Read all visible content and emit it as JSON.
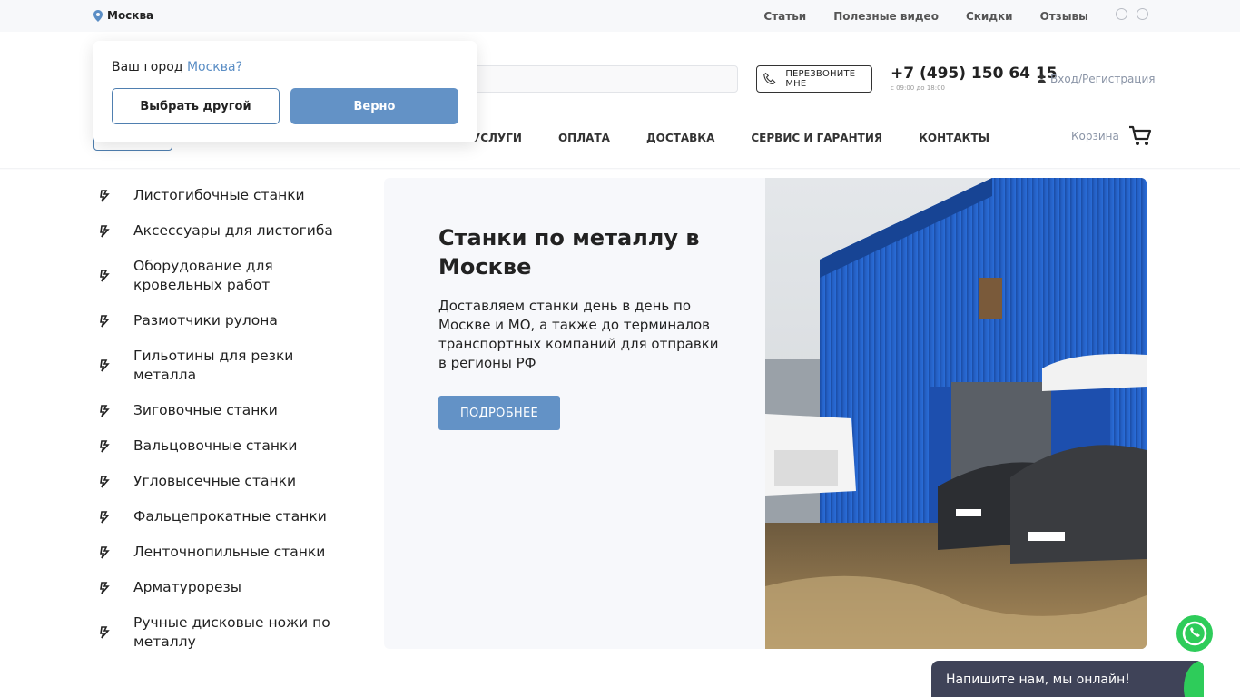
{
  "topbar": {
    "city": "Москва",
    "links": [
      "Статьи",
      "Полезные видео",
      "Скидки",
      "Отзывы"
    ]
  },
  "header": {
    "callback_label": "ПЕРЕЗВОНИТЕ МНЕ",
    "phone": "+7 (495) 150 64 15",
    "hours": "с 09:00 до 18:00",
    "login_label": "Вход/Регистрация"
  },
  "nav": {
    "items": [
      "УСЛУГИ",
      "ОПЛАТА",
      "ДОСТАВКА",
      "СЕРВИС И ГАРАНТИЯ",
      "КОНТАКТЫ"
    ],
    "cart_label": "Корзина"
  },
  "city_popup": {
    "question": "Ваш город",
    "city": "Москва?",
    "choose_other": "Выбрать другой",
    "confirm": "Верно"
  },
  "sidebar": {
    "items": [
      "Листогибочные станки",
      "Аксессуары для листогиба",
      "Оборудование для кровельных работ",
      "Размотчики рулона",
      "Гильотины для резки металла",
      "Зиговочные станки",
      "Вальцовочные станки",
      "Угловысечные станки",
      "Фальцепрокатные станки",
      "Ленточнопильные станки",
      "Арматурорезы",
      "Ручные дисковые ножи по металлу"
    ]
  },
  "banner": {
    "title": "Станки по металлу в Москве",
    "text": "Доставляем станки день в день по Москве и МО, а также до терминалов транспортных компаний для отправки в регионы РФ",
    "button": "ПОДРОБНЕЕ"
  },
  "chat": {
    "label": "Напишите нам, мы онлайн!"
  },
  "colors": {
    "accent": "#6392c6",
    "whatsapp": "#2ecc5a",
    "chat_bg": "#3f4358"
  }
}
